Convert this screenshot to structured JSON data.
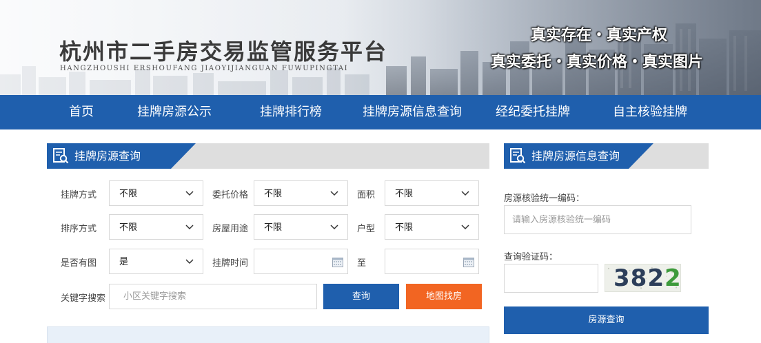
{
  "header": {
    "title": "杭州市二手房交易监管服务平台",
    "subtitle": "HANGZHOUSHI   ERSHOUFANG  JIAOYIJIANGUAN   FUWUPINGTAI",
    "slogan_line1": "真实存在・真实产权",
    "slogan_line2": "真实委托・真实价格・真实图片"
  },
  "nav": {
    "items": [
      {
        "label": "首页"
      },
      {
        "label": "挂牌房源公示"
      },
      {
        "label": "挂牌排行榜"
      },
      {
        "label": "挂牌房源信息查询"
      },
      {
        "label": "经纪委托挂牌"
      },
      {
        "label": "自主核验挂牌"
      }
    ]
  },
  "search_panel": {
    "title": "挂牌房源查询",
    "filters": {
      "listing_method": {
        "label": "挂牌方式",
        "value": "不限"
      },
      "price": {
        "label": "委托价格",
        "value": "不限"
      },
      "area": {
        "label": "面积",
        "value": "不限"
      },
      "sort": {
        "label": "排序方式",
        "value": "不限"
      },
      "usage": {
        "label": "房屋用途",
        "value": "不限"
      },
      "layout": {
        "label": "户型",
        "value": "不限"
      },
      "has_photo": {
        "label": "是否有图",
        "value": "是"
      },
      "listing_time": {
        "label": "挂牌时间",
        "to_label": "至",
        "from_value": "",
        "to_value": ""
      }
    },
    "keyword": {
      "label": "关键字搜索",
      "placeholder": "小区关键字搜索",
      "value": ""
    },
    "search_button": "查询",
    "map_button": "地图找房"
  },
  "verify_panel": {
    "title": "挂牌房源信息查询",
    "code_label": "房源核验统一编码：",
    "code_placeholder": "请输入房源核验统一编码",
    "code_value": "",
    "captcha_label": "查询验证码：",
    "captcha_value": "",
    "captcha_text_main": "382",
    "captcha_text_last": "2",
    "submit_button": "房源查询"
  },
  "colors": {
    "primary_blue": "#1f5fad",
    "orange": "#f26522",
    "panel_gray": "#dedede"
  },
  "icons": {
    "panel_header": "search-document-icon",
    "dropdown": "chevron-down-icon",
    "date_picker": "calendar-icon"
  }
}
